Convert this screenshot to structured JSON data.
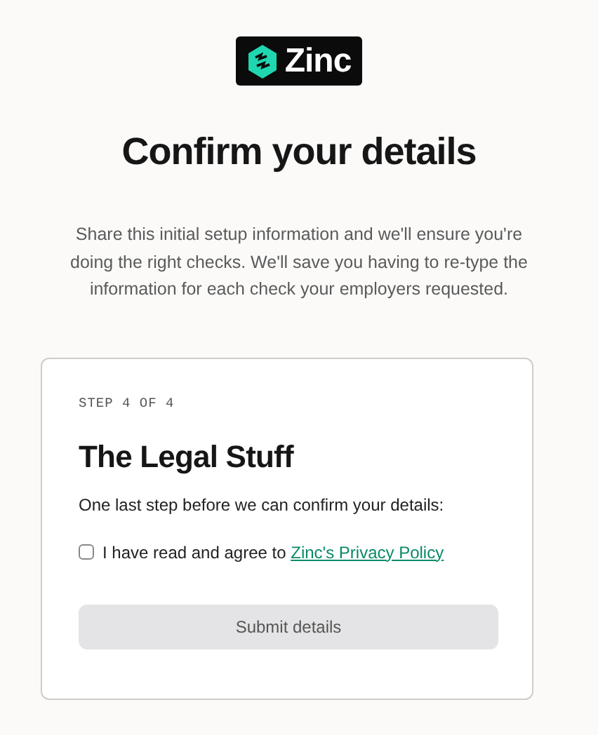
{
  "logo": {
    "text": "Zinc"
  },
  "title": "Confirm your details",
  "intro": "Share this initial setup information and we'll ensure you're doing the right checks. We'll save you having to re-type the information for each check your employers requested.",
  "card": {
    "step": "STEP 4 OF 4",
    "heading": "The Legal Stuff",
    "lead": "One last step before we can confirm your details:",
    "agreement": {
      "checked": false,
      "text": "I have read and agree to",
      "link": "Zinc's Privacy Policy"
    },
    "submit": {
      "label": "Submit details",
      "disabled": true
    }
  }
}
